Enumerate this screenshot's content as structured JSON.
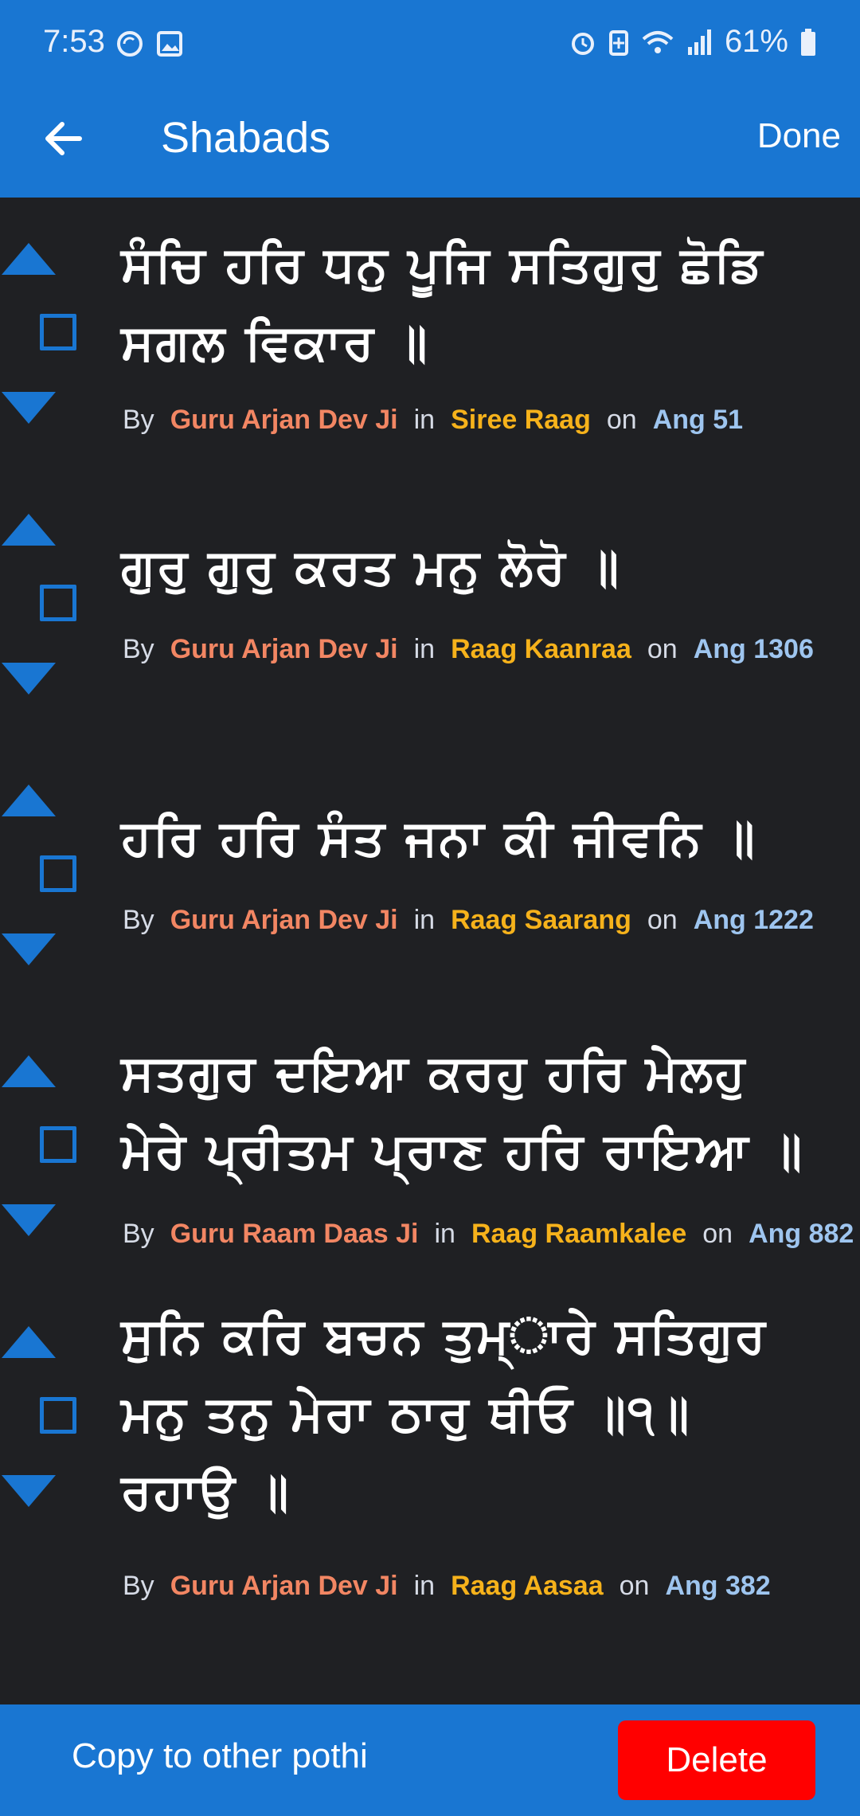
{
  "status_bar": {
    "time": "7:53",
    "battery_text": "61%",
    "left_icons": [
      "sync-icon",
      "image-icon"
    ],
    "right_icons": [
      "alarm-icon",
      "battery-saver-icon",
      "wifi-icon",
      "signal-icon",
      "battery-icon"
    ]
  },
  "app_bar": {
    "title": "Shabads",
    "done_label": "Done",
    "back_icon": "arrow-left-icon"
  },
  "shabads": [
    {
      "gurbani_lines": [
        "ਸੰਚਿ ਹਰਿ ਧਨੁ ਪੂਜਿ ਸਤਿਗੁਰੁ ਛੋਡਿ",
        "ਸਗਲ ਵਿਕਾਰ ॥"
      ],
      "by": "By",
      "writer": "Guru Arjan Dev Ji",
      "in": "in",
      "raag": "Siree Raag",
      "on": "on",
      "ang": "Ang 51"
    },
    {
      "gurbani_lines": [
        "ਗੁਰੁ ਗੁਰੁ ਕਰਤ ਮਨੁ ਲੋਰੋ ॥"
      ],
      "by": "By",
      "writer": "Guru Arjan Dev Ji",
      "in": "in",
      "raag": "Raag Kaanraa",
      "on": "on",
      "ang": "Ang 1306"
    },
    {
      "gurbani_lines": [
        "ਹਰਿ ਹਰਿ ਸੰਤ ਜਨਾ ਕੀ ਜੀਵਨਿ ॥"
      ],
      "by": "By",
      "writer": "Guru Arjan Dev Ji",
      "in": "in",
      "raag": "Raag Saarang",
      "on": "on",
      "ang": "Ang 1222"
    },
    {
      "gurbani_lines": [
        "ਸਤਗੁਰ ਦਇਆ ਕਰਹੁ ਹਰਿ ਮੇਲਹੁ",
        "ਮੇਰੇ ਪ੍ਰੀਤਮ ਪ੍ਰਾਣ ਹਰਿ ਰਾਇਆ ॥"
      ],
      "by": "By",
      "writer": "Guru Raam Daas Ji",
      "in": "in",
      "raag": "Raag Raamkalee",
      "on": "on",
      "ang": "Ang 882"
    },
    {
      "gurbani_lines": [
        "ਸੁਨਿ ਕਰਿ ਬਚਨ ਤੁਮ੍ਾਰੇ ਸਤਿਗੁਰ",
        "ਮਨੁ ਤਨੁ ਮੇਰਾ ਠਾਰੁ ਥੀਓ ॥੧॥",
        "ਰਹਾਉ ॥"
      ],
      "by": "By",
      "writer": "Guru Arjan Dev Ji",
      "in": "in",
      "raag": "Raag Aasaa",
      "on": "on",
      "ang": "Ang 382"
    }
  ],
  "bottom_bar": {
    "copy_label": "Copy to other pothi",
    "delete_label": "Delete"
  },
  "colors": {
    "accent": "#1976d2",
    "background": "#1f2023",
    "writer": "#f28663",
    "raag": "#f6b21b",
    "ang": "#9ec5ef",
    "delete": "#ff0000"
  }
}
